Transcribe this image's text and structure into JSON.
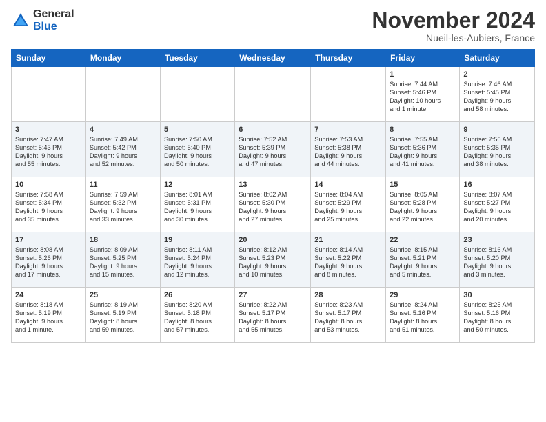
{
  "logo": {
    "general": "General",
    "blue": "Blue"
  },
  "header": {
    "month": "November 2024",
    "location": "Nueil-les-Aubiers, France"
  },
  "weekdays": [
    "Sunday",
    "Monday",
    "Tuesday",
    "Wednesday",
    "Thursday",
    "Friday",
    "Saturday"
  ],
  "weeks": [
    [
      {
        "day": "",
        "info": ""
      },
      {
        "day": "",
        "info": ""
      },
      {
        "day": "",
        "info": ""
      },
      {
        "day": "",
        "info": ""
      },
      {
        "day": "",
        "info": ""
      },
      {
        "day": "1",
        "info": "Sunrise: 7:44 AM\nSunset: 5:46 PM\nDaylight: 10 hours\nand 1 minute."
      },
      {
        "day": "2",
        "info": "Sunrise: 7:46 AM\nSunset: 5:45 PM\nDaylight: 9 hours\nand 58 minutes."
      }
    ],
    [
      {
        "day": "3",
        "info": "Sunrise: 7:47 AM\nSunset: 5:43 PM\nDaylight: 9 hours\nand 55 minutes."
      },
      {
        "day": "4",
        "info": "Sunrise: 7:49 AM\nSunset: 5:42 PM\nDaylight: 9 hours\nand 52 minutes."
      },
      {
        "day": "5",
        "info": "Sunrise: 7:50 AM\nSunset: 5:40 PM\nDaylight: 9 hours\nand 50 minutes."
      },
      {
        "day": "6",
        "info": "Sunrise: 7:52 AM\nSunset: 5:39 PM\nDaylight: 9 hours\nand 47 minutes."
      },
      {
        "day": "7",
        "info": "Sunrise: 7:53 AM\nSunset: 5:38 PM\nDaylight: 9 hours\nand 44 minutes."
      },
      {
        "day": "8",
        "info": "Sunrise: 7:55 AM\nSunset: 5:36 PM\nDaylight: 9 hours\nand 41 minutes."
      },
      {
        "day": "9",
        "info": "Sunrise: 7:56 AM\nSunset: 5:35 PM\nDaylight: 9 hours\nand 38 minutes."
      }
    ],
    [
      {
        "day": "10",
        "info": "Sunrise: 7:58 AM\nSunset: 5:34 PM\nDaylight: 9 hours\nand 35 minutes."
      },
      {
        "day": "11",
        "info": "Sunrise: 7:59 AM\nSunset: 5:32 PM\nDaylight: 9 hours\nand 33 minutes."
      },
      {
        "day": "12",
        "info": "Sunrise: 8:01 AM\nSunset: 5:31 PM\nDaylight: 9 hours\nand 30 minutes."
      },
      {
        "day": "13",
        "info": "Sunrise: 8:02 AM\nSunset: 5:30 PM\nDaylight: 9 hours\nand 27 minutes."
      },
      {
        "day": "14",
        "info": "Sunrise: 8:04 AM\nSunset: 5:29 PM\nDaylight: 9 hours\nand 25 minutes."
      },
      {
        "day": "15",
        "info": "Sunrise: 8:05 AM\nSunset: 5:28 PM\nDaylight: 9 hours\nand 22 minutes."
      },
      {
        "day": "16",
        "info": "Sunrise: 8:07 AM\nSunset: 5:27 PM\nDaylight: 9 hours\nand 20 minutes."
      }
    ],
    [
      {
        "day": "17",
        "info": "Sunrise: 8:08 AM\nSunset: 5:26 PM\nDaylight: 9 hours\nand 17 minutes."
      },
      {
        "day": "18",
        "info": "Sunrise: 8:09 AM\nSunset: 5:25 PM\nDaylight: 9 hours\nand 15 minutes."
      },
      {
        "day": "19",
        "info": "Sunrise: 8:11 AM\nSunset: 5:24 PM\nDaylight: 9 hours\nand 12 minutes."
      },
      {
        "day": "20",
        "info": "Sunrise: 8:12 AM\nSunset: 5:23 PM\nDaylight: 9 hours\nand 10 minutes."
      },
      {
        "day": "21",
        "info": "Sunrise: 8:14 AM\nSunset: 5:22 PM\nDaylight: 9 hours\nand 8 minutes."
      },
      {
        "day": "22",
        "info": "Sunrise: 8:15 AM\nSunset: 5:21 PM\nDaylight: 9 hours\nand 5 minutes."
      },
      {
        "day": "23",
        "info": "Sunrise: 8:16 AM\nSunset: 5:20 PM\nDaylight: 9 hours\nand 3 minutes."
      }
    ],
    [
      {
        "day": "24",
        "info": "Sunrise: 8:18 AM\nSunset: 5:19 PM\nDaylight: 9 hours\nand 1 minute."
      },
      {
        "day": "25",
        "info": "Sunrise: 8:19 AM\nSunset: 5:19 PM\nDaylight: 8 hours\nand 59 minutes."
      },
      {
        "day": "26",
        "info": "Sunrise: 8:20 AM\nSunset: 5:18 PM\nDaylight: 8 hours\nand 57 minutes."
      },
      {
        "day": "27",
        "info": "Sunrise: 8:22 AM\nSunset: 5:17 PM\nDaylight: 8 hours\nand 55 minutes."
      },
      {
        "day": "28",
        "info": "Sunrise: 8:23 AM\nSunset: 5:17 PM\nDaylight: 8 hours\nand 53 minutes."
      },
      {
        "day": "29",
        "info": "Sunrise: 8:24 AM\nSunset: 5:16 PM\nDaylight: 8 hours\nand 51 minutes."
      },
      {
        "day": "30",
        "info": "Sunrise: 8:25 AM\nSunset: 5:16 PM\nDaylight: 8 hours\nand 50 minutes."
      }
    ]
  ]
}
